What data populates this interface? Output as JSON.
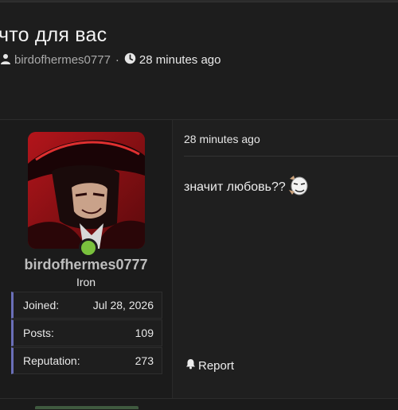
{
  "thread": {
    "title": "что для вас",
    "author": "birdofhermes0777",
    "separator": "·",
    "time": "28 minutes ago"
  },
  "post": {
    "user": {
      "username": "birdofhermes0777",
      "rank": "Iron",
      "online": true
    },
    "stats": [
      {
        "label": "Joined:",
        "value": "Jul 28, 2026"
      },
      {
        "label": "Posts:",
        "value": "109"
      },
      {
        "label": "Reputation:",
        "value": "273"
      }
    ],
    "time": "28 minutes ago",
    "body": "значит любовь??",
    "report_label": "Report"
  },
  "icons": {
    "author": "user-icon",
    "time": "clock-icon",
    "report": "bell-icon",
    "emoji": "face-emoji-icon"
  },
  "colors": {
    "background": "#1d1d1d",
    "online": "#7ac13d",
    "stat_accent": "#6a6fb8"
  }
}
